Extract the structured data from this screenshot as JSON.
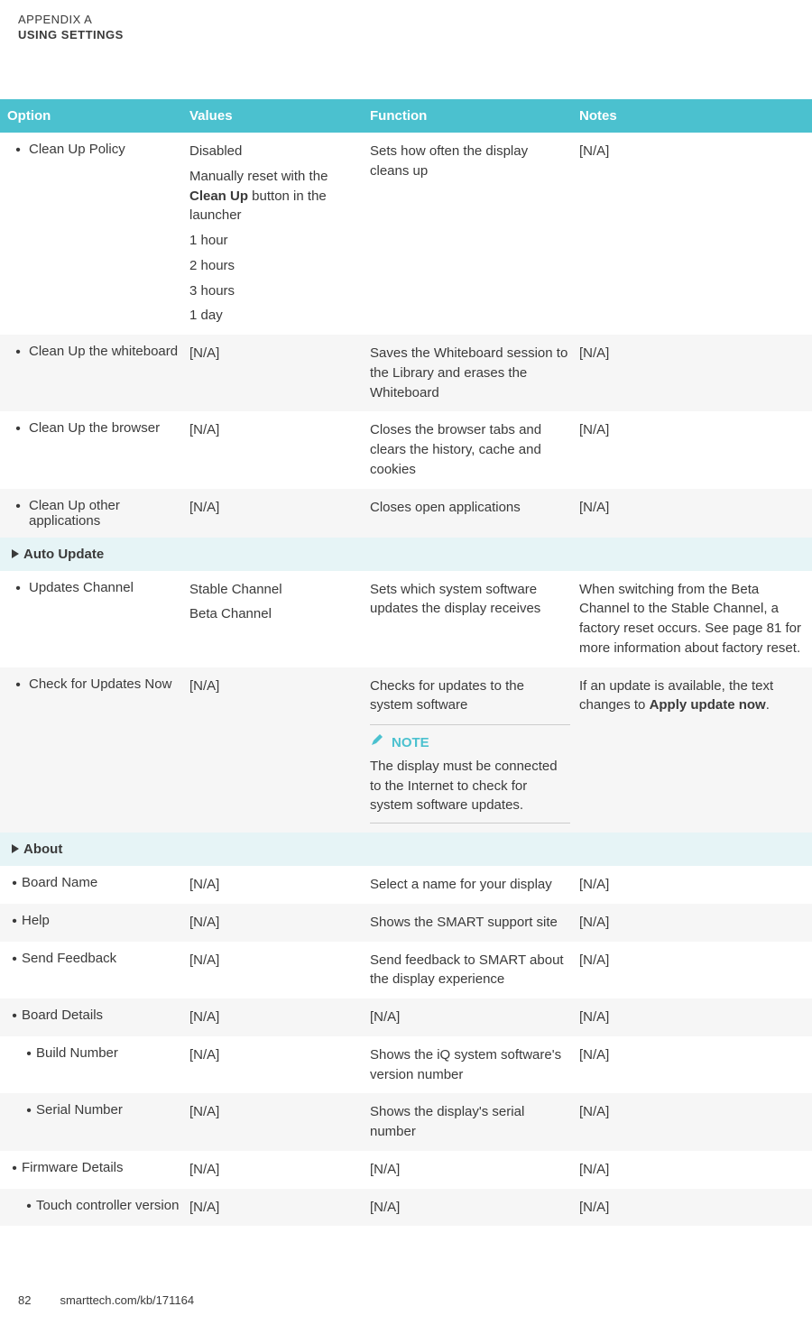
{
  "header": {
    "appendix": "APPENDIX A",
    "title": "USING SETTINGS"
  },
  "columns": {
    "c1": "Option",
    "c2": "Values",
    "c3": "Function",
    "c4": "Notes"
  },
  "na": "[N/A]",
  "rows": {
    "r1": {
      "opt": "Clean Up Policy",
      "vals": {
        "v1": "Disabled",
        "v2a": "Manually reset with the ",
        "v2b": "Clean Up",
        "v2c": " button in the launcher",
        "v3": "1 hour",
        "v4": "2 hours",
        "v5": "3 hours",
        "v6": "1 day"
      },
      "func": "Sets how often the display cleans up"
    },
    "r2": {
      "opt": "Clean Up the whiteboard",
      "func": "Saves the Whiteboard session to the Library and erases the Whiteboard"
    },
    "r3": {
      "opt": "Clean Up the browser",
      "func": "Closes the browser tabs and clears the history, cache and cookies"
    },
    "r4": {
      "opt": "Clean Up other applications",
      "func": "Closes open applications"
    },
    "s1": "Auto Update",
    "r5": {
      "opt": "Updates Channel",
      "vals": {
        "v1": "Stable Channel",
        "v2": "Beta Channel"
      },
      "func": "Sets which system software updates the display receives",
      "notes": "When switching from the Beta Channel to the Stable Channel, a factory reset occurs. See page 81 for more information about factory reset."
    },
    "r6": {
      "opt": "Check for Updates Now",
      "func": "Checks for updates to the system software",
      "noteLabel": "NOTE",
      "noteText": "The display must be connected to the Internet to check for system software updates.",
      "notesA": "If an update is available, the text changes to ",
      "notesB": "Apply update now",
      "notesC": "."
    },
    "s2": "About",
    "r7": {
      "opt": "Board Name",
      "func": "Select a name for your display"
    },
    "r8": {
      "opt": "Help",
      "func": "Shows the SMART support site"
    },
    "r9": {
      "opt": "Send Feedback",
      "func": "Send feedback to SMART about the display experience"
    },
    "r10": {
      "opt": "Board Details"
    },
    "r11": {
      "opt": "Build Number",
      "func": "Shows the iQ system software's version number"
    },
    "r12": {
      "opt": "Serial Number",
      "func": "Shows the display's serial number"
    },
    "r13": {
      "opt": "Firmware Details"
    },
    "r14": {
      "opt": "Touch controller version"
    }
  },
  "footer": {
    "page": "82",
    "url": "smarttech.com/kb/171164"
  }
}
